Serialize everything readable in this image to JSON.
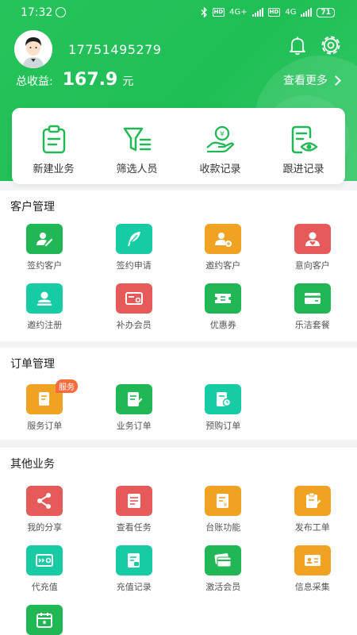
{
  "status_bar": {
    "time": "17:32",
    "hd1": "HD",
    "net1": "4G+",
    "hd2": "HD",
    "net2": "4G",
    "battery": "71"
  },
  "header": {
    "phone": "17751495279",
    "total_label": "总收益:",
    "total_amount": "167.9",
    "currency_unit": "元",
    "more_label": "查看更多"
  },
  "quick_actions": [
    {
      "label": "新建业务",
      "icon": "clipboard-icon"
    },
    {
      "label": "筛选人员",
      "icon": "filter-icon"
    },
    {
      "label": "收款记录",
      "icon": "payment-icon"
    },
    {
      "label": "跟进记录",
      "icon": "document-eye-icon"
    }
  ],
  "customer": {
    "title": "客户管理",
    "items": [
      {
        "label": "签约客户",
        "icon": "sign-user-icon",
        "color": "#22b755"
      },
      {
        "label": "签约申请",
        "icon": "feather-icon",
        "color": "#17cba4"
      },
      {
        "label": "邀约客户",
        "icon": "invite-user-icon",
        "color": "#f0a323"
      },
      {
        "label": "意向客户",
        "icon": "heart-user-icon",
        "color": "#e65a5a"
      },
      {
        "label": "邀约注册",
        "icon": "register-icon",
        "color": "#17cba4"
      },
      {
        "label": "补办会员",
        "icon": "member-card-icon",
        "color": "#e65a5a"
      },
      {
        "label": "优惠券",
        "icon": "coupon-icon",
        "color": "#22b755"
      },
      {
        "label": "乐洁套餐",
        "icon": "package-card-icon",
        "color": "#22b755"
      }
    ]
  },
  "orders": {
    "title": "订单管理",
    "badge": "服务",
    "items": [
      {
        "label": "服务订单",
        "icon": "service-order-icon",
        "color": "#f0a323"
      },
      {
        "label": "业务订单",
        "icon": "business-order-icon",
        "color": "#22b755"
      },
      {
        "label": "预购订单",
        "icon": "preorder-icon",
        "color": "#17cba4"
      }
    ]
  },
  "other": {
    "title": "其他业务",
    "items": [
      {
        "label": "我的分享",
        "icon": "share-icon",
        "color": "#e65a5a"
      },
      {
        "label": "查看任务",
        "icon": "task-list-icon",
        "color": "#e65a5a"
      },
      {
        "label": "台账功能",
        "icon": "ledger-icon",
        "color": "#f0a323"
      },
      {
        "label": "发布工单",
        "icon": "publish-order-icon",
        "color": "#f0a323"
      },
      {
        "label": "代充值",
        "icon": "recharge-icon",
        "color": "#17cba4"
      },
      {
        "label": "充值记录",
        "icon": "recharge-record-icon",
        "color": "#17cba4"
      },
      {
        "label": "激活会员",
        "icon": "activate-card-icon",
        "color": "#22b755"
      },
      {
        "label": "信息采集",
        "icon": "id-card-icon",
        "color": "#f0a323"
      },
      {
        "label": "",
        "icon": "calendar-icon",
        "color": "#22b755"
      }
    ]
  }
}
